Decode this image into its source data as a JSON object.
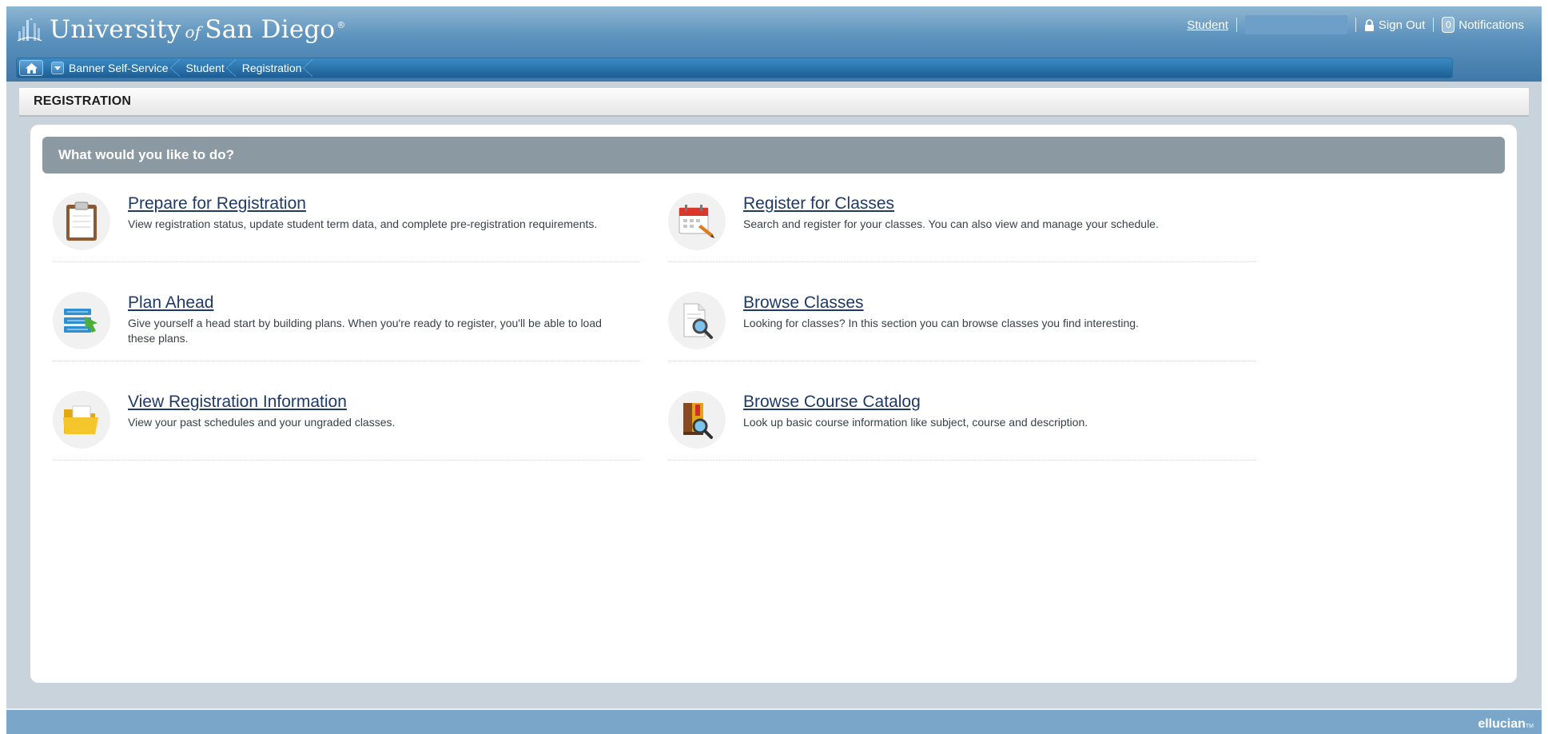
{
  "header": {
    "logo_main": "University",
    "logo_of": "of",
    "logo_end": "San Diego",
    "logo_reg": "®",
    "student_link": "Student",
    "sign_out": "Sign Out",
    "notification_count": "0",
    "notifications": "Notifications"
  },
  "breadcrumb": [
    "Banner Self-Service",
    "Student",
    "Registration"
  ],
  "page": {
    "title": "REGISTRATION",
    "question": "What would you like to do?"
  },
  "items": [
    {
      "title": "Prepare for Registration",
      "desc": "View registration status, update student term data, and complete pre-registration requirements.",
      "icon": "clipboard-icon"
    },
    {
      "title": "Register for Classes",
      "desc": "Search and register for your classes. You can also view and manage your schedule.",
      "icon": "calendar-pencil-icon"
    },
    {
      "title": "Plan Ahead",
      "desc": "Give yourself a head start by building plans. When you're ready to register, you'll be able to load these plans.",
      "icon": "stacked-plans-icon"
    },
    {
      "title": "Browse Classes",
      "desc": "Looking for classes? In this section you can browse classes you find interesting.",
      "icon": "document-search-icon"
    },
    {
      "title": "View Registration Information",
      "desc": "View your past schedules and your ungraded classes.",
      "icon": "folder-icon"
    },
    {
      "title": "Browse Course Catalog",
      "desc": "Look up basic course information like subject, course and description.",
      "icon": "book-search-icon"
    }
  ],
  "footer": {
    "brand": "ellucian",
    "tm": "TM"
  },
  "colors": {
    "header_top": "#8fb6d2",
    "header_bottom": "#3f79a8",
    "question_bar": "#8b99a3",
    "link": "#1f3a66",
    "footer": "#7aa7c9"
  }
}
